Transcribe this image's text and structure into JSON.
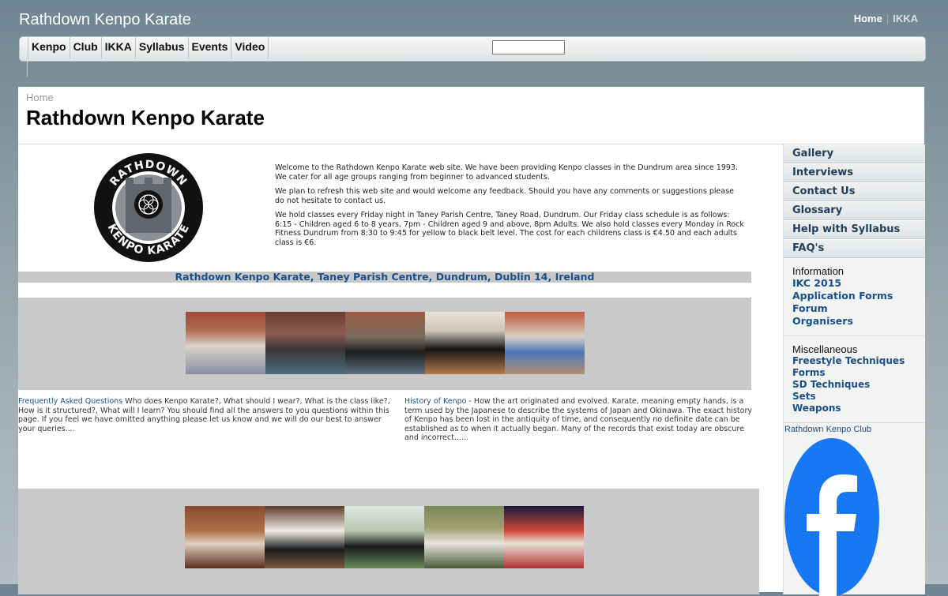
{
  "site": {
    "title": "Rathdown Kenpo Karate"
  },
  "top_links": [
    "Home",
    "IKKA"
  ],
  "nav": {
    "items": [
      "Kenpo",
      "Club",
      "IKKA",
      "Syllabus",
      "Events",
      "Video"
    ],
    "search_value": ""
  },
  "breadcrumb": "Home",
  "page_title": "Rathdown Kenpo Karate",
  "logo": {
    "top_text": "RATHDOWN",
    "bottom_text": "KENPO KARATE"
  },
  "intro": {
    "p1": "Welcome to the Rathdown Kenpo Karate web site. We have been providing Kenpo classes in the Dundrum area since 1993. We cater for all age groups ranging from beginner to advanced students.",
    "p2": "We plan to refresh this web site and would welcome any feedback. Should you have any comments or suggestions please do not hesitate to contact us.",
    "p3": "We hold classes every Friday night in Taney Parish Centre, Taney Road, Dundrum. Our Friday class schedule is as follows: 6:15 - Children aged 6 to 8 years, 7pm - Children aged 9 and above, 8pm Adults. We also hold classes every Monday in Rock Fitness Dundrum from 8:30 to 9:45 for yellow to black belt level. The cost for each childrens class is €4.50 and each adults class is €6."
  },
  "address": "Rathdown Kenpo Karate, Taney Parish Centre, Dundrum, Dublin 14, Ireland",
  "faq": {
    "link": "Frequently Asked Questions",
    "text": " Who does Kenpo Karate?, What should I wear?, What is the class like?, How is it structured?, What will I learn? You should find all the answers to you questions within this page. If you feel we have omitted anything please let us know and we will do our best to answer your queries...."
  },
  "history": {
    "link": "History of Kenpo",
    "text": " - How the art originated and evolved. Karate, meaning empty hands, is a term used by the Japanese to describe the systems of Japan and Okinawa. The exact history of Kenpo has been lost in the antiquity of time, and consequently no definite date can be established as to when it actually began. Many of the records that exist today are obscure and incorrect......"
  },
  "sidebar": {
    "menu": [
      "Gallery",
      "Interviews",
      "Contact Us",
      "Glossary",
      "Help with Syllabus",
      "FAQ's"
    ],
    "information": {
      "heading": "Information",
      "links": [
        "IKC 2015",
        "Application Forms",
        "Forum",
        "Organisers"
      ]
    },
    "misc": {
      "heading": "Miscellaneous",
      "links": [
        "Freestyle Techniques",
        "Forms",
        "SD Techniques",
        "Sets",
        "Weapons"
      ]
    },
    "facebook_label": "Rathdown Kenpo Club"
  },
  "colors": {
    "link": "#1a4f8a",
    "facebook": "#1877f2",
    "band": "#c9c9c9"
  },
  "icons": [
    "facebook-logo",
    "club-logo"
  ]
}
